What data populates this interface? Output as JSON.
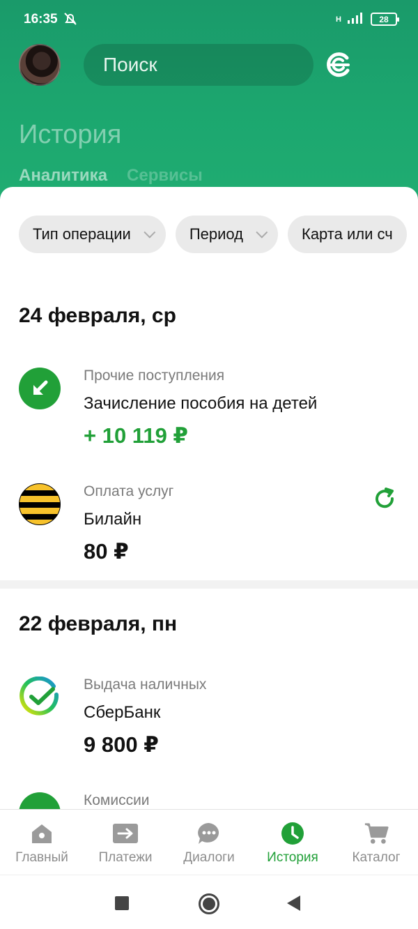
{
  "status": {
    "time": "16:35",
    "battery": "28",
    "network": "H"
  },
  "header": {
    "search_placeholder": "Поиск",
    "title": "История",
    "tabs": [
      "Аналитика",
      "Сервисы"
    ]
  },
  "filters": [
    "Тип операции",
    "Период",
    "Карта или сч"
  ],
  "groups": [
    {
      "date": "24 февраля, ср",
      "items": [
        {
          "category": "Прочие поступления",
          "name": "Зачисление пособия на детей",
          "amount": "+ 10 119 ₽",
          "icon": "arrow-in-icon"
        },
        {
          "category": "Оплата услуг",
          "name": "Билайн",
          "amount": "80 ₽",
          "icon": "beeline-logo"
        }
      ]
    },
    {
      "date": "22 февраля, пн",
      "items": [
        {
          "category": "Выдача наличных",
          "name": "СберБанк",
          "amount": "9 800 ₽",
          "icon": "sberbank-logo"
        },
        {
          "category": "Комиссии",
          "icon": "percent-icon"
        }
      ]
    }
  ],
  "bottom_nav": [
    {
      "label": "Главный",
      "icon": "home-icon"
    },
    {
      "label": "Платежи",
      "icon": "payments-arrow-icon"
    },
    {
      "label": "Диалоги",
      "icon": "chat-icon"
    },
    {
      "label": "История",
      "icon": "clock-icon",
      "active": true
    },
    {
      "label": "Каталог",
      "icon": "cart-icon"
    }
  ],
  "colors": {
    "brand_green": "#21a038",
    "header_green": "#1ca76f",
    "beeline_yellow": "#f7c22b"
  }
}
